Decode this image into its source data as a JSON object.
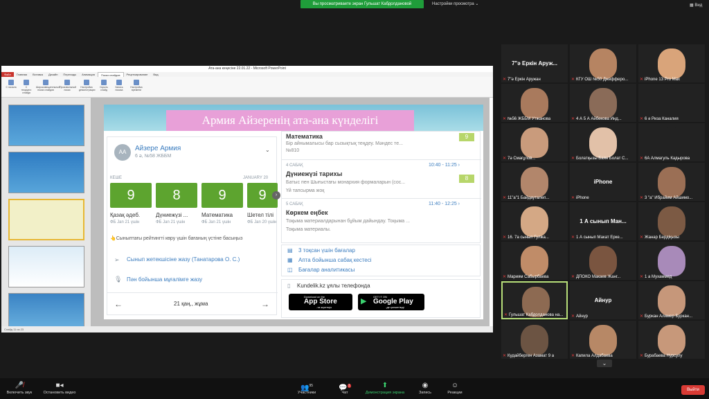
{
  "banner": "Вы просматриваете экран Гульшат Кабдолдановой",
  "view_options": "Настройки просмотра ⌄",
  "view_label": "▦ Вид",
  "ppt": {
    "window_title": "Ата-ана кеңесіне 22.01.22 - Microsoft PowerPoint",
    "tabs": [
      "Файл",
      "Главная",
      "Вставка",
      "Дизайн",
      "Переходы",
      "Анимация",
      "Показ слайдов",
      "Рецензирование",
      "Вид"
    ],
    "active_tab": 6,
    "ribbon": [
      "С начала",
      "С текущего слайда",
      "Широковещательный показ слайдов",
      "Произвольный показ",
      "Настройка демонстрации",
      "Скрыть слайд",
      "Запись показа",
      "Настройка времени"
    ],
    "status": "Слайд 11 из 23"
  },
  "slide": {
    "title": "Армия Айзеренің ата-ана күнделігі",
    "student": {
      "initials": "AA",
      "name": "Айзере Армия",
      "class": "6 ә, №58 ЖББМ"
    },
    "yesterday": "КЕШЕ",
    "date_label": "JANUARY 20",
    "grades": [
      {
        "value": "9",
        "subject": "Қазақ әдеб.",
        "date": "ФБ Jan 21 үшін"
      },
      {
        "value": "8",
        "subject": "Дүниежүзі ...",
        "date": "ФБ Jan 21 үшін"
      },
      {
        "value": "9",
        "subject": "Математика",
        "date": "ФБ Jan 21 үшін"
      },
      {
        "value": "9",
        "subject": "Шетел тілі",
        "date": "ФБ Jan 20 үшін"
      }
    ],
    "rating_hint": "👆Сыныптағы рейтингті көру үшін бағаның үстіне басыңыз",
    "write_teacher": "Сынып жетекшісіне жазу (Танатарова О. С.)",
    "write_subject": "Пән бойынша мұғалімге жазу",
    "nav_date": "21 қаң., жұма",
    "lessons": [
      {
        "tag": "",
        "time": "",
        "name": "Математика",
        "desc": "Бір айнымалысы бар сызықтық теңдеу. Мәндес те...",
        "desc2": "№810",
        "mark": "9"
      },
      {
        "tag": "4 САБАҚ",
        "time": "10:40 - 11:25 ›",
        "name": "Дүниежүзі тарихы",
        "desc": "Батыс пен Шығыстағы монархия формаларын (сос...",
        "desc2": "Үй тапсырма жоқ",
        "mark": "8"
      },
      {
        "tag": "5 САБАҚ",
        "time": "11:40 - 12:25 ›",
        "name": "Көркем еңбек",
        "desc": "Тоқыма материалдарынан бұйым дайындау. Тоқыма ...",
        "desc2": "Тоқыма материалы.",
        "mark": ""
      }
    ],
    "links": [
      "3 тоқсан үшін бағалар",
      "Апта бойынша сабақ кестесі",
      "Бағалар аналитикасы"
    ],
    "app_promo": "Kundelik.kz ұялы телефонда",
    "app_store": {
      "small": "Download on the",
      "big": "App Store",
      "sub": "-та жүктеңіз"
    },
    "google_play": {
      "small": "GET IT ON",
      "big": "Google Play",
      "sub": "-де қолжетімді"
    }
  },
  "participants": [
    {
      "name": "7\"ә Еркін Аружан",
      "center": "7\"ә Еркін Аруж..."
    },
    {
      "name": "КГУ ОШ №50 Джефферо...",
      "face": "#b68462"
    },
    {
      "name": "iPhone 13 Pro Max",
      "face": "#d9a47a"
    },
    {
      "name": "№56 ЖББМ Утжанова",
      "face": "#a97a5d"
    },
    {
      "name": "4 А 5 А Айбекова Инд...",
      "face": "#8a6b58"
    },
    {
      "name": "6 ә Риза Каналия",
      "face": "#222"
    },
    {
      "name": "7ә Смағұлов...",
      "face": "#c99b7c"
    },
    {
      "name": "Болатқызы Баян Болат С...",
      "face": "#e2c1a8"
    },
    {
      "name": "6А Алмагуль Кадырова",
      "face": "#222"
    },
    {
      "name": "11\"а\"1 Байдауталеп...",
      "face": "#b2866b"
    },
    {
      "name": "iPhone",
      "center": "iPhone"
    },
    {
      "name": "3 \"а\" Ибрайим Айшимо...",
      "face": "#9b6f55"
    },
    {
      "name": "16. 7а сынып Гулжа...",
      "face": "#d4a885"
    },
    {
      "name": "1 А сынып Макат Ерке...",
      "center": "1 А сынып Ман..."
    },
    {
      "name": "Жанар Бердіқызы",
      "face": "#7c5a44"
    },
    {
      "name": "Мариям Сабырбаева",
      "face": "#c08c68"
    },
    {
      "name": "ДПОКО Макаев Жанг...",
      "face": "#7a5540"
    },
    {
      "name": "1 а Мухаммед",
      "face": "#a88ab9"
    },
    {
      "name": "Гульшат Кабдолданова на...",
      "face": "#8d6a52",
      "hl": true
    },
    {
      "name": "Айнур",
      "center": "Айнур"
    },
    {
      "name": "Буркан Алимер Буркан...",
      "face": "#c6977a"
    },
    {
      "name": "Кудайберген Азамат 9 а",
      "face": "#6c5443"
    },
    {
      "name": "Капила Алдабаева",
      "face": "#b78866"
    },
    {
      "name": "Бурабаева Нурсулу",
      "face": "#c7987a"
    }
  ],
  "toolbar": {
    "mute": "Включить звук",
    "video": "Остановить видео",
    "participants": "Участники",
    "participants_count": "95",
    "chat": "Чат",
    "chat_badge": "1",
    "share": "Демонстрация экрана",
    "record": "Запись",
    "reactions": "Реакции",
    "leave": "Выйти"
  },
  "colors": {
    "zoom_green": "#1f9d3a",
    "leave_red": "#d93b35",
    "grade_green": "#5da42f",
    "highlight": "#b8e07a"
  }
}
